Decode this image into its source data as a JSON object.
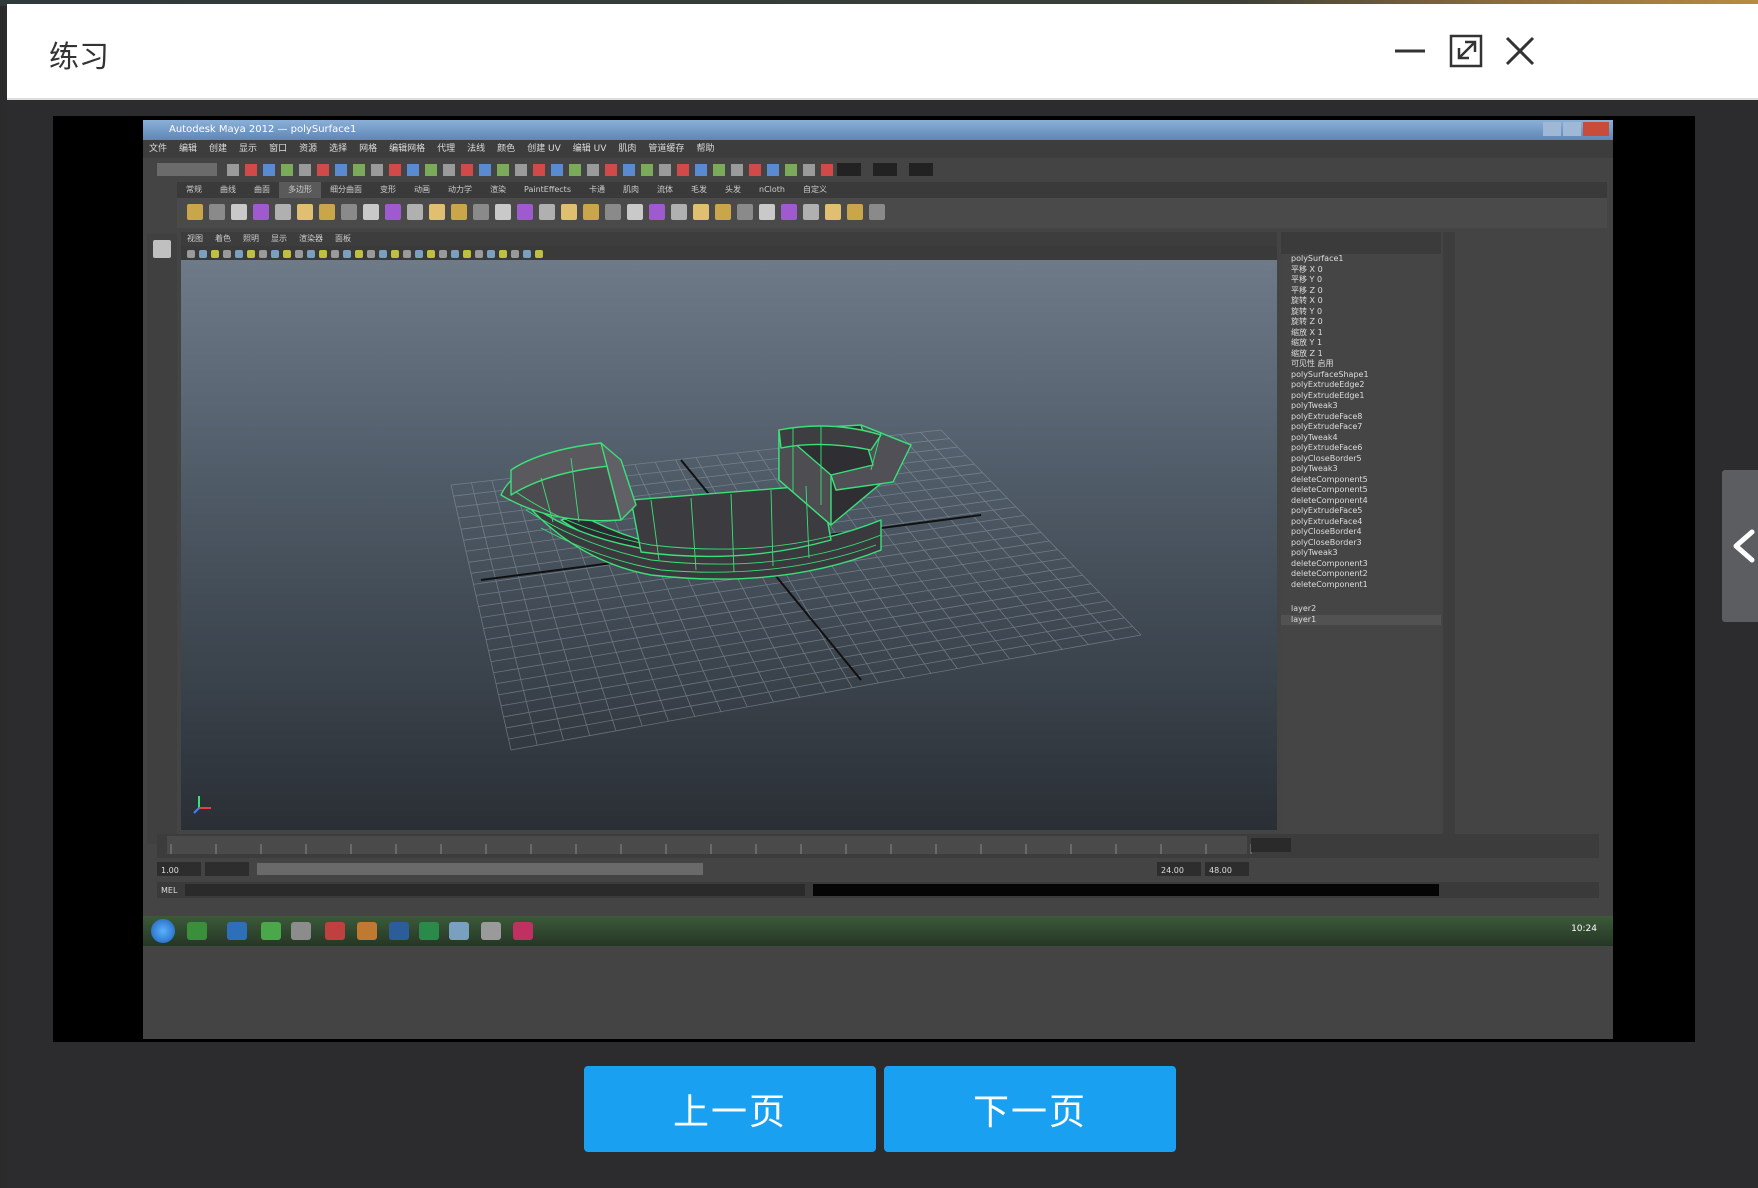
{
  "window": {
    "title": "练习",
    "minimize_label": "—",
    "maximize_label": "⤢",
    "close_label": "✕"
  },
  "navigation": {
    "prev_label": "上一页",
    "next_label": "下一页",
    "side_toggle_icon": "chevron-left-icon"
  },
  "colors": {
    "button_bg": "#1aa0f0",
    "dialog_bg": "#2c2c2e",
    "wireframe": "#3be07a"
  },
  "maya": {
    "menu_items": [
      "文件",
      "编辑",
      "创建",
      "显示",
      "窗口",
      "资源",
      "选择",
      "网格",
      "编辑网格",
      "代理",
      "法线",
      "颜色",
      "创建 UV",
      "编辑 UV",
      "肌肉",
      "管道缓存",
      "帮助"
    ],
    "shelf_tabs": [
      "常规",
      "曲线",
      "曲面",
      "多边形",
      "细分曲面",
      "变形",
      "动画",
      "动力学",
      "渲染",
      "PaintEffects",
      "卡通",
      "肌肉",
      "流体",
      "毛发",
      "头发",
      "nCloth",
      "自定义"
    ],
    "panel_menu": [
      "视图",
      "着色",
      "照明",
      "显示",
      "渲染器",
      "面板"
    ],
    "object_name": "polySurface1",
    "attr_channels": [
      "平移 X 0",
      "平移 Y 0",
      "平移 Z 0",
      "旋转 X 0",
      "旋转 Y 0",
      "旋转 Z 0",
      "缩放 X 1",
      "缩放 Y 1",
      "缩放 Z 1",
      "可见性 启用"
    ],
    "history": [
      "polySurfaceShape1",
      "polyExtrudeEdge2",
      "polyExtrudeEdge1",
      "polyTweak3",
      "polyExtrudeFace8",
      "polyExtrudeFace7",
      "polyTweak4",
      "polyExtrudeFace6",
      "polyCloseBorder5",
      "polyTweak3",
      "deleteComponent5",
      "deleteComponent5",
      "deleteComponent4",
      "polyExtrudeFace5",
      "polyExtrudeFace4",
      "polyCloseBorder4",
      "polyCloseBorder3",
      "polyTweak3",
      "deleteComponent3",
      "deleteComponent2",
      "deleteComponent1"
    ],
    "layers": [
      "layer2",
      "layer1"
    ],
    "time_start": "1.00",
    "time_end": "24.00",
    "range_end": "48.00",
    "current_frame": "1.00"
  }
}
